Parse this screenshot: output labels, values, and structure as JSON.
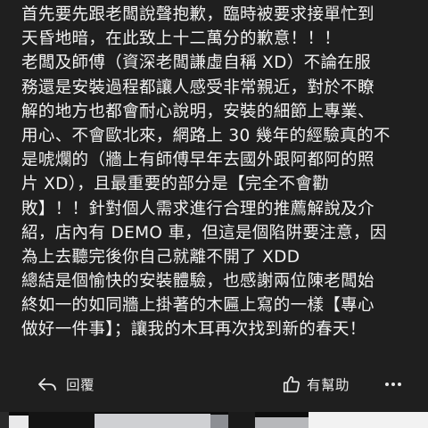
{
  "review": {
    "lines": [
      "首先要先跟老闆說聲抱歉，臨時被要求接單忙到",
      "天昏地暗，在此致上十二萬分的歉意！！！",
      "老闆及師傅（資深老闆謙虛自稱 XD）不論在服",
      "務還是安裝過程都讓人感受非常親近，對於不瞭",
      "解的地方也都會耐心說明，安裝的細節上專業、",
      "用心、不會歐北來，網路上 30 幾年的經驗真的不",
      "是唬爛的（牆上有師傅早年去國外跟阿都阿的照",
      "片 XD），且最重要的部分是【完全不會勸",
      "敗】！！針對個人需求進行合理的推薦解說及介",
      "紹，店內有 DEMO 車，但這是個陷阱要注意，因",
      "為上去聽完後你自己就離不開了 XDD",
      "總結是個愉快的安裝體驗，也感謝兩位陳老闆始",
      "終如一的如同牆上掛著的木匾上寫的一樣【專心",
      "做好一件事】；讓我的木耳再次找到新的春天！"
    ]
  },
  "actions": {
    "reply_label": "回覆",
    "reply_icon": "reply-arrow-icon",
    "helpful_label": "有幫助",
    "helpful_icon": "thumbs-up-icon",
    "more_icon": "more-horizontal-icon"
  },
  "colors": {
    "card_background": "#1f1f1f",
    "page_background": "#000000",
    "text": "#f2f2f2"
  }
}
